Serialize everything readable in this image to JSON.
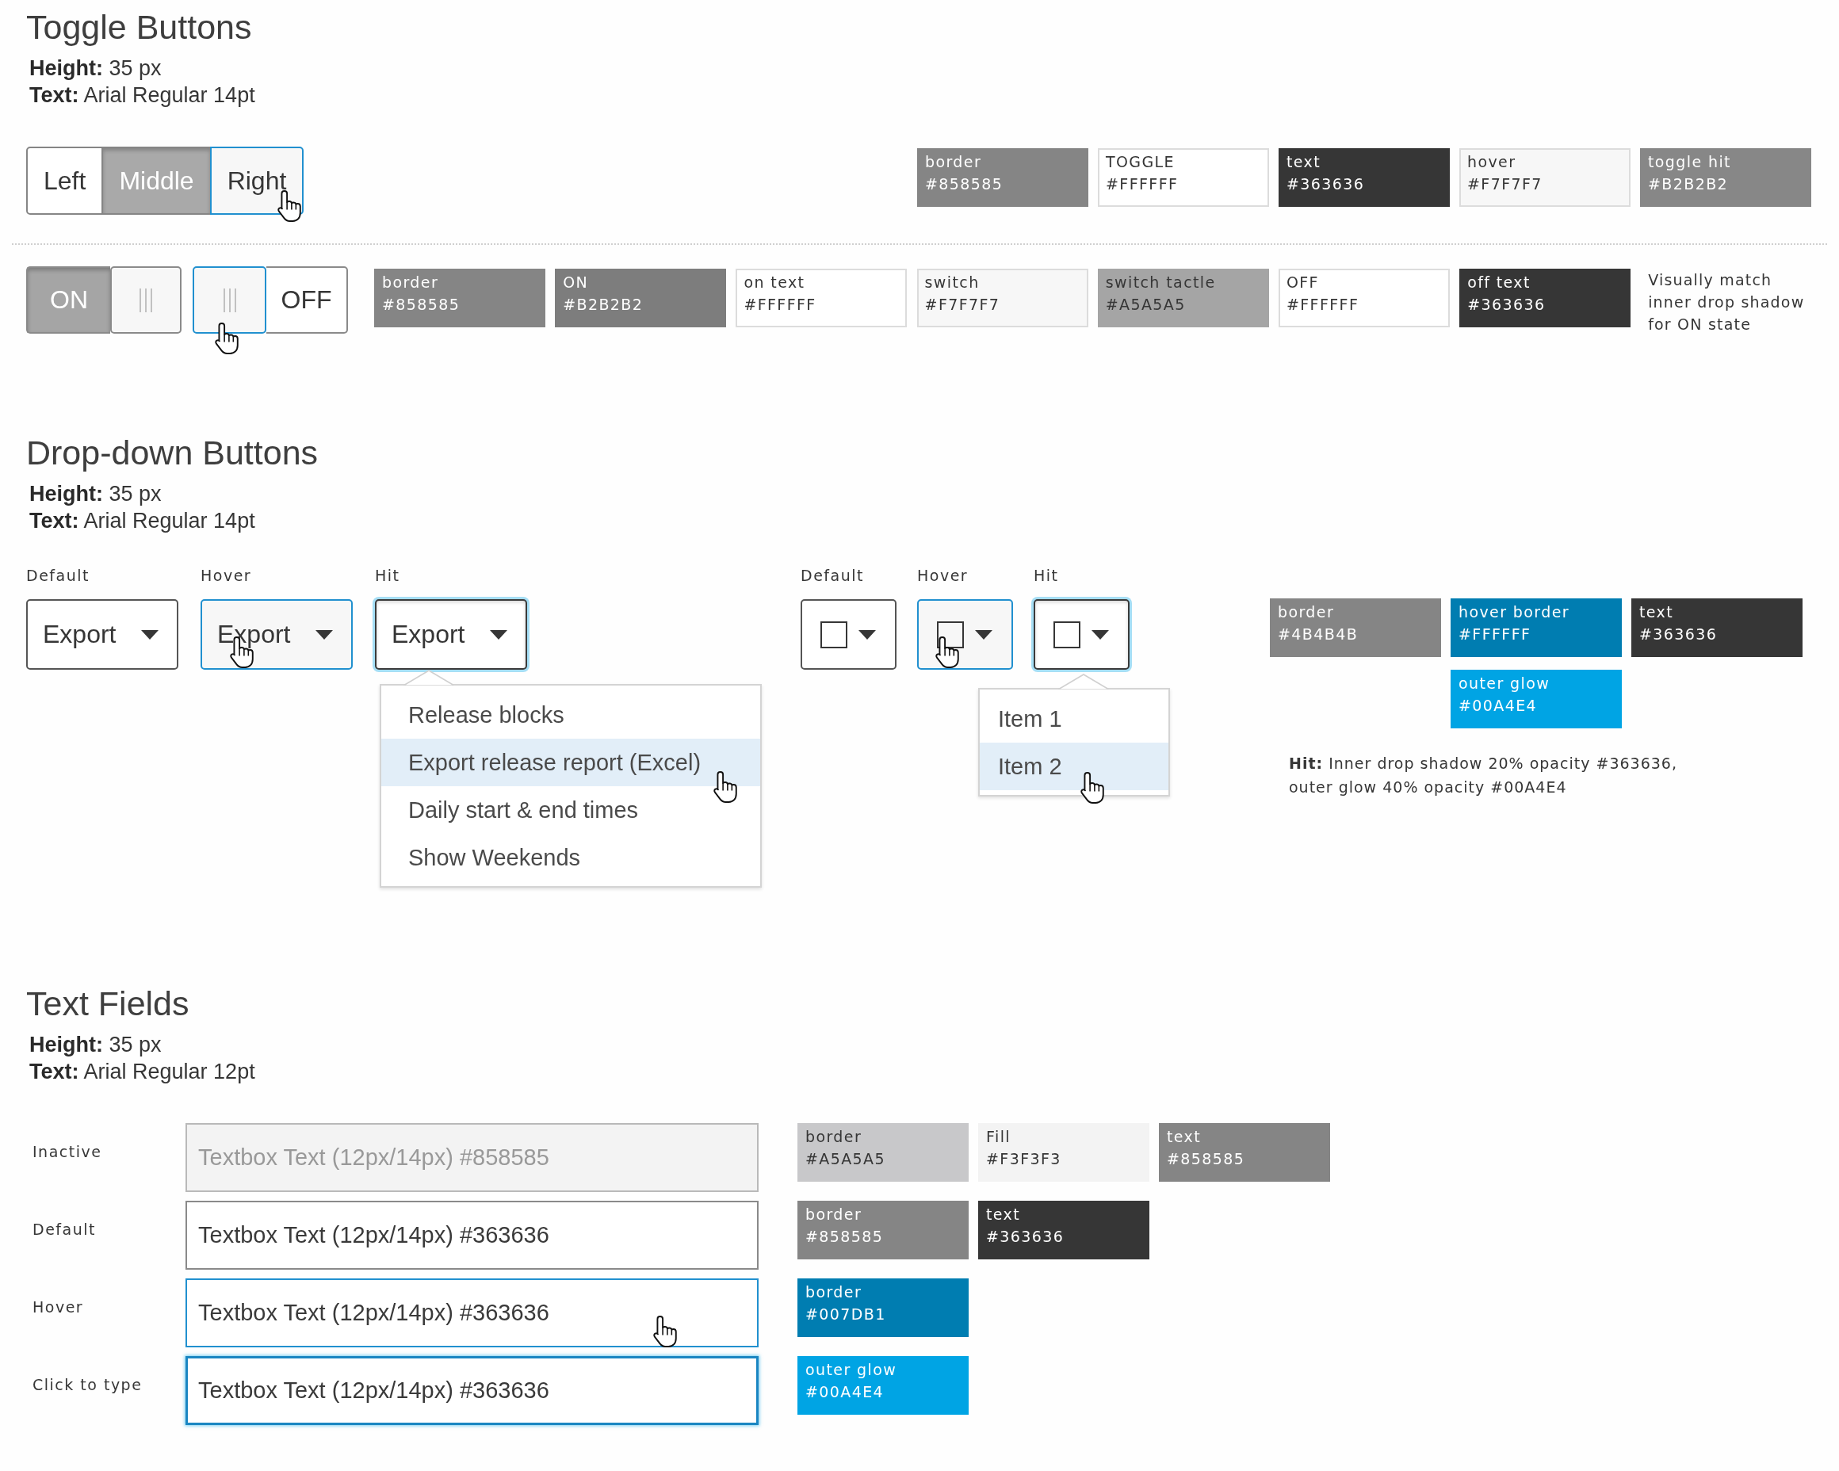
{
  "toggle_buttons": {
    "title": "Toggle Buttons",
    "specs": [
      "**Height:** 35 px",
      "**Text:** Arial Regular 14pt"
    ],
    "segments": [
      {
        "label": "Left",
        "selected": false,
        "hover": false
      },
      {
        "label": "Middle",
        "selected": true,
        "hover": false
      },
      {
        "label": "Right",
        "selected": false,
        "hover": true
      }
    ],
    "segment_swatches": [
      {
        "label": "border",
        "value": "#858585",
        "color": "#858585"
      },
      {
        "label": "TOGGLE",
        "value": "#FFFFFF",
        "color": "#ffffff"
      },
      {
        "label": "text",
        "value": "#363636",
        "color": "#363636"
      },
      {
        "label": "hover",
        "value": "#F7F7F7",
        "color": "#f7f7f7"
      },
      {
        "label": "toggle hit",
        "value": "#B2B2B2",
        "color": "#878787"
      }
    ],
    "switches": [
      {
        "label": "ON",
        "on": true,
        "hover": false
      },
      {
        "label": "OFF",
        "on": false,
        "hover": true
      }
    ],
    "switch_swatches": [
      {
        "label": "border",
        "value": "#858585",
        "color": "#858585"
      },
      {
        "label": "ON",
        "value": "#B2B2B2",
        "color": "#7d7d7d"
      },
      {
        "label": "on text",
        "value": "#FFFFFF",
        "color": "#ffffff"
      },
      {
        "label": "switch",
        "value": "#F7F7F7",
        "color": "#f7f7f7"
      },
      {
        "label": "switch tactle",
        "value": "#A5A5A5",
        "color": "#a5a5a5"
      },
      {
        "label": "OFF",
        "value": "#FFFFFF",
        "color": "#ffffff"
      },
      {
        "label": "off text",
        "value": "#363636",
        "color": "#363636"
      }
    ],
    "switch_note": "Visually match inner drop shadow for ON state"
  },
  "dropdown_buttons": {
    "title": "Drop-down Buttons",
    "specs": [
      "**Height:** 35 px",
      "**Text:** Arial Regular 14pt"
    ],
    "groups": [
      {
        "kind": "text",
        "buttons": [
          {
            "caption": "Default",
            "label": "Export",
            "hover": false,
            "pressed": false
          },
          {
            "caption": "Hover",
            "label": "Export",
            "hover": true,
            "pressed": false
          },
          {
            "caption": "Hit",
            "label": "Export",
            "hover": false,
            "pressed": true,
            "menu": [
              {
                "label": "Release blocks",
                "selected": false
              },
              {
                "label": "Export release report (Excel)",
                "selected": true
              },
              {
                "label": "Daily start & end times",
                "selected": false
              },
              {
                "label": "Show Weekends",
                "selected": false
              }
            ]
          }
        ]
      },
      {
        "kind": "icon",
        "buttons": [
          {
            "caption": "Default",
            "hover": false,
            "pressed": false
          },
          {
            "caption": "Hover",
            "hover": true,
            "pressed": false
          },
          {
            "caption": "Hit",
            "hover": false,
            "pressed": true,
            "menu": [
              {
                "label": "Item 1",
                "selected": false
              },
              {
                "label": "Item 2",
                "selected": true
              }
            ]
          }
        ]
      }
    ],
    "swatch_rows": [
      [
        {
          "label": "border",
          "value": "#4B4B4B",
          "color": "#858585"
        },
        {
          "label": "hover border",
          "value": "#FFFFFF",
          "color": "#007db1"
        },
        {
          "label": "text",
          "value": "#363636",
          "color": "#363636"
        }
      ],
      [
        {
          "label": "outer glow",
          "value": "#00A4E4",
          "color": "#00a4e4"
        }
      ]
    ],
    "note": "**Hit:** Inner drop shadow 20% opacity #363636, outer glow 40% opacity #00A4E4"
  },
  "text_fields": {
    "title": "Text Fields",
    "specs": [
      "**Height:** 35 px",
      "**Text:** Arial Regular 12pt"
    ],
    "fields": [
      {
        "label": "Inactive",
        "value": "Textbox Text (12px/14px) #858585",
        "disabled": true,
        "hover": false,
        "focused": false,
        "swatches": [
          {
            "label": "border",
            "value": "#A5A5A5",
            "color": "#c8c8ca"
          },
          {
            "label": "Fill",
            "value": "#F3F3F3",
            "color": "#f3f3f3"
          },
          {
            "label": "text",
            "value": "#858585",
            "color": "#858585"
          }
        ]
      },
      {
        "label": "Default",
        "value": "Textbox Text (12px/14px) #363636",
        "disabled": false,
        "hover": false,
        "focused": false,
        "swatches": [
          {
            "label": "border",
            "value": "#858585",
            "color": "#858585"
          },
          {
            "label": "text",
            "value": "#363636",
            "color": "#363636"
          }
        ]
      },
      {
        "label": "Hover",
        "value": "Textbox Text (12px/14px) #363636",
        "disabled": false,
        "hover": true,
        "focused": false,
        "swatches": [
          {
            "label": "border",
            "value": "#007DB1",
            "color": "#007db1"
          }
        ]
      },
      {
        "label": "Click to type",
        "value": "Textbox Text (12px/14px) #363636",
        "disabled": false,
        "hover": false,
        "focused": true,
        "swatches": [
          {
            "label": "outer glow",
            "value": "#00A4E4",
            "color": "#00a4e4"
          }
        ]
      }
    ]
  }
}
